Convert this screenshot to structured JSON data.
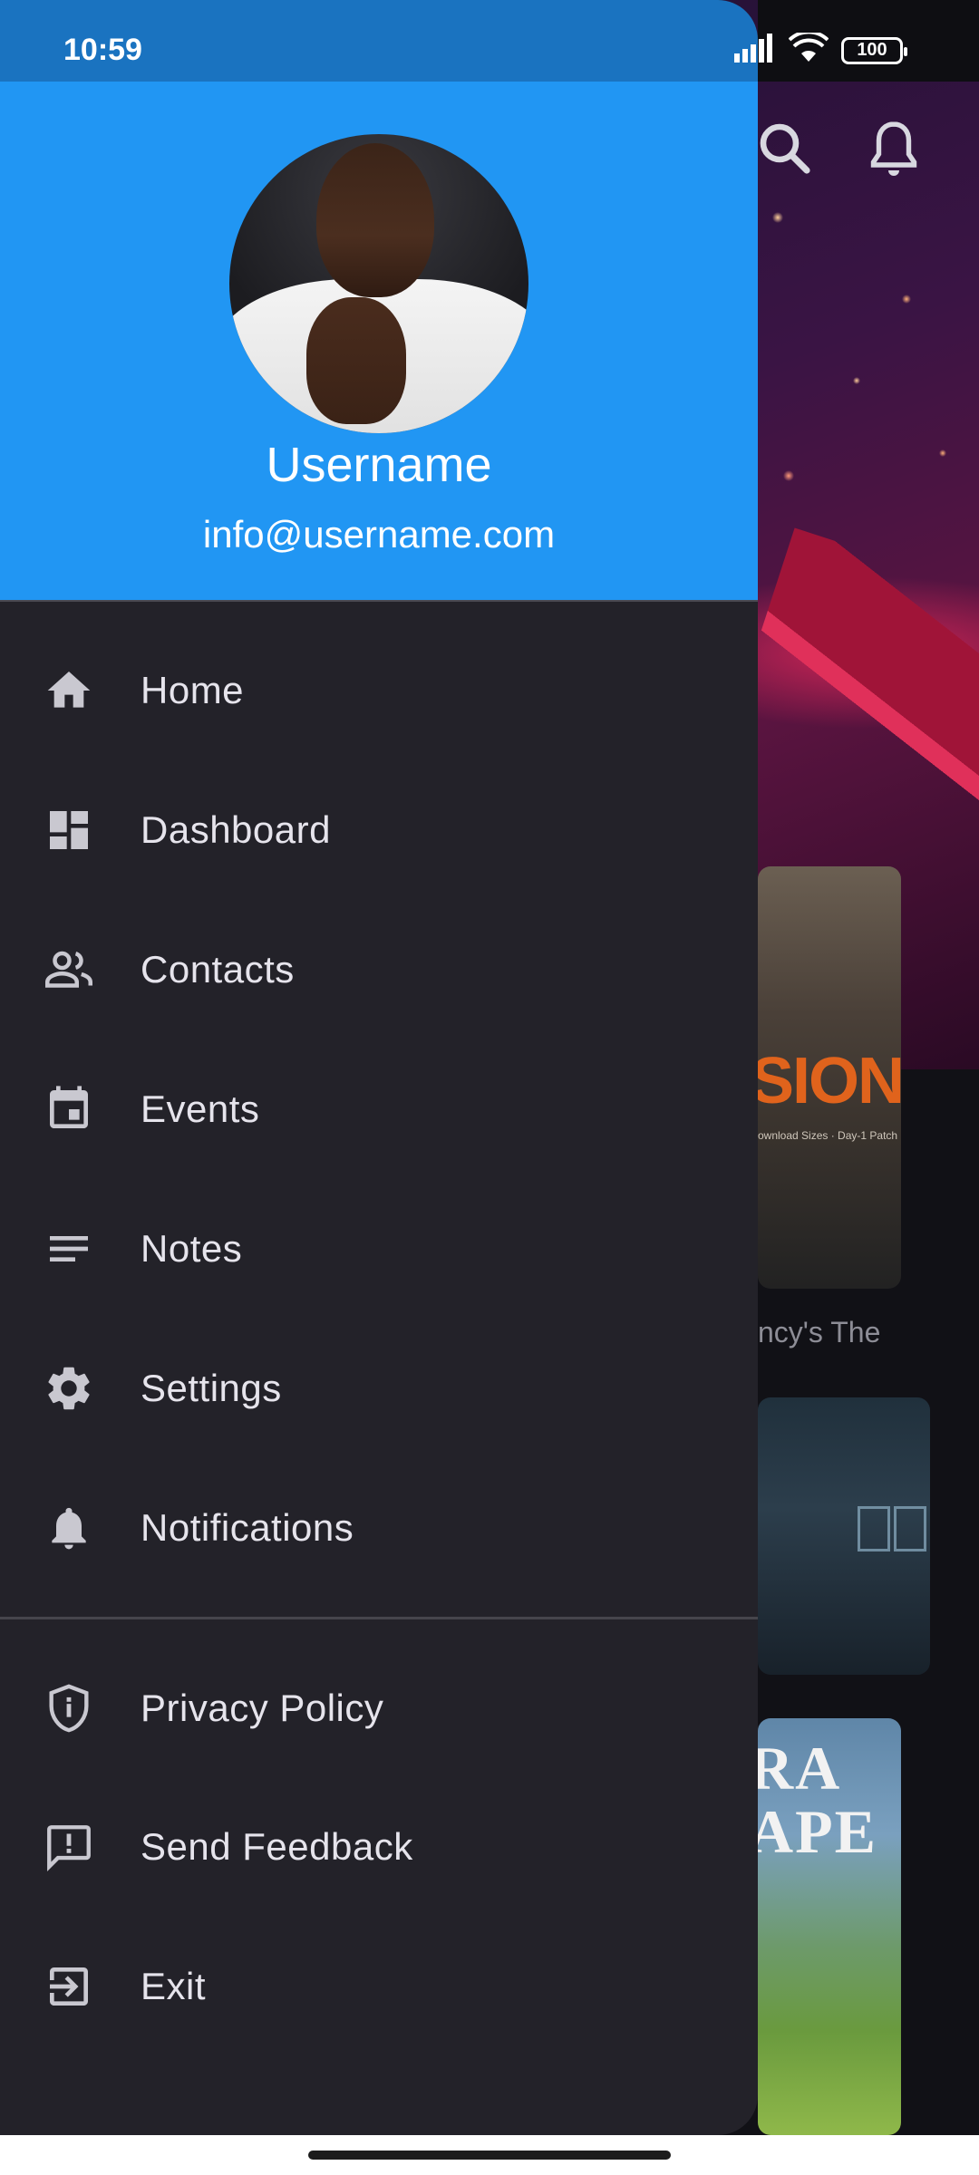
{
  "status_bar": {
    "time": "10:59",
    "battery": "100"
  },
  "drawer": {
    "header": {
      "username": "Username",
      "email": "info@username.com"
    },
    "items": [
      {
        "label": "Home",
        "icon": "home-icon"
      },
      {
        "label": "Dashboard",
        "icon": "dashboard-icon"
      },
      {
        "label": "Contacts",
        "icon": "contacts-icon"
      },
      {
        "label": "Events",
        "icon": "event-icon"
      },
      {
        "label": "Notes",
        "icon": "notes-icon"
      },
      {
        "label": "Settings",
        "icon": "gear-icon"
      },
      {
        "label": "Notifications",
        "icon": "bell-icon"
      }
    ],
    "secondary_items": [
      {
        "label": "Privacy Policy",
        "icon": "shield-icon"
      },
      {
        "label": "Send Feedback",
        "icon": "feedback-icon"
      },
      {
        "label": "Exit",
        "icon": "exit-icon"
      }
    ]
  },
  "background_app": {
    "card1_title": "SION",
    "card1_subtitle": "ownload Sizes · Day-1 Patch",
    "card1_caption": "ncy's The",
    "card3_title": "RA\nAPE"
  },
  "colors": {
    "header": "#2196f3",
    "status_bar": "#1a73c0",
    "drawer_bg": "#232229",
    "text": "#e6e4ec"
  }
}
